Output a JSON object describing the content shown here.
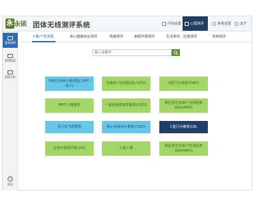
{
  "header": {
    "logo_text": "永硕",
    "title": "团体无线测评系统",
    "buttons": [
      {
        "label": "问询设置",
        "icon": "clipboard-icon"
      },
      {
        "label": "心理测评",
        "icon": "shield-icon",
        "active": true
      },
      {
        "label": "系统设置",
        "icon": "gear-icon"
      },
      {
        "label": "关于",
        "icon": "info-icon"
      }
    ]
  },
  "sidebar": {
    "items": [
      {
        "label": "量表选择",
        "active": true
      },
      {
        "label": "选择档案"
      },
      {
        "label": "档案分析"
      }
    ],
    "exit_label": "退出"
  },
  "tabs": [
    "人格/个性测验",
    "身心健康综合测评",
    "情绪测评",
    "家庭环境测评",
    "生活事件、应激测评",
    "专用测评"
  ],
  "search": {
    "placeholder": "输入关键字"
  },
  "tiles": [
    {
      "label": "卡特尔16种人格测验(16PF - 成人)",
      "color": "cyan"
    },
    {
      "label": "艾森克个性测验(成人EPQ)",
      "color": "green"
    },
    {
      "label": "A型行为测验(TABP)",
      "color": "green"
    },
    {
      "label": "MBTI人格量表",
      "color": "green"
    },
    {
      "label": "一般自我效能感量表(GSES)",
      "color": "green"
    },
    {
      "label": "明尼苏达多相个性测验表566(MMPI)",
      "color": "green"
    },
    {
      "label": "青少年气质量表",
      "color": "cyan"
    },
    {
      "label": "核心自我评价量表(CSES)",
      "color": "cyan"
    },
    {
      "label": "C型行为量表(CB)",
      "color": "navy"
    },
    {
      "label": "生命价值观问卷(LVS)",
      "color": "green"
    },
    {
      "label": "九型人格",
      "color": "green"
    },
    {
      "label": "明尼苏达多相个性测验表399(MMPI)",
      "color": "green"
    }
  ],
  "colors": {
    "cyan": "#68c6e8",
    "green": "#a4d667",
    "navy": "#1e3e6b",
    "accent": "#2f6bb3"
  }
}
